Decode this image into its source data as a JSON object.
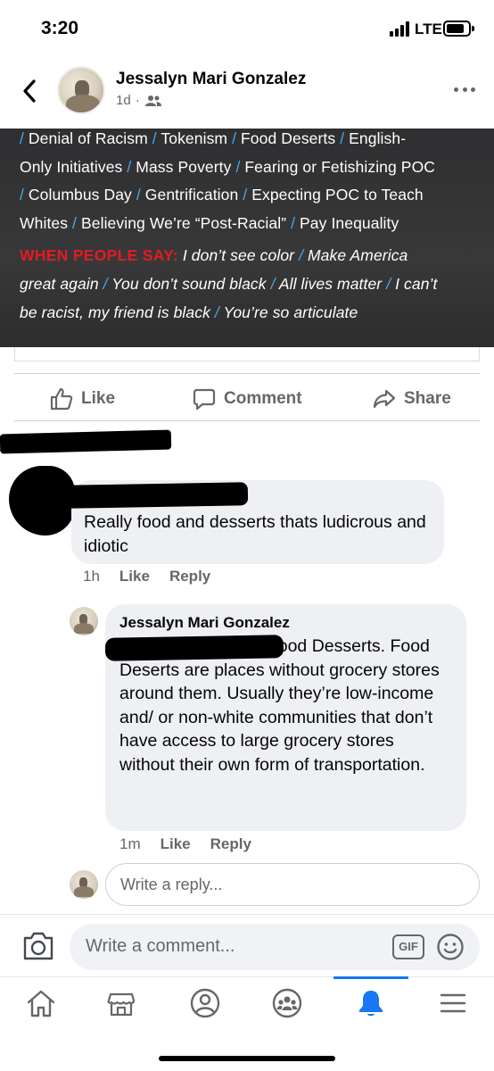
{
  "status": {
    "time": "3:20",
    "network": "LTE"
  },
  "post": {
    "author": "Jessalyn Mari Gonzalez",
    "time": "1d",
    "meta_sep": "·",
    "image": {
      "lines": [
        {
          "segments": [
            "/",
            " Denial of Racism ",
            "/",
            " Tokenism ",
            "/",
            " Food Deserts ",
            "/",
            " English-"
          ]
        },
        {
          "segments": [
            "Only Initiatives ",
            "/",
            " Mass Poverty ",
            "/",
            " Fearing or Fetishizing POC"
          ]
        },
        {
          "segments": [
            "/",
            " Columbus Day ",
            "/",
            " Gentrification ",
            "/",
            " Expecting POC to Teach"
          ]
        },
        {
          "segments": [
            "Whites ",
            "/",
            " Believing We’re “Post-Racial” ",
            "/",
            " Pay Inequality"
          ]
        },
        {
          "heading": "WHEN PEOPLE SAY:",
          "segments": [
            " I don’t see color ",
            "/",
            " Make America"
          ]
        },
        {
          "segments": [
            "great again ",
            "/",
            " You don’t sound black ",
            "/",
            " All lives matter ",
            "/",
            " I can’t"
          ]
        },
        {
          "segments": [
            "be racist, my friend is black ",
            "/",
            " You’re so articulate"
          ]
        }
      ]
    }
  },
  "actions": {
    "like": "Like",
    "comment": "Comment",
    "share": "Share"
  },
  "comments": [
    {
      "text": "Really food and desserts thats ludicrous and idiotic",
      "time": "1h",
      "like": "Like",
      "reply": "Reply"
    }
  ],
  "reply": {
    "author": "Jessalyn Mari Gonzalez",
    "text": ", Food Deserts not Food Desserts. Food Deserts are places without grocery stores around them. Usually they’re low-income and/ or non-white communities that don’t have access to large grocery stores without their own form of transportation.",
    "time": "1m",
    "like": "Like",
    "reply": "Reply"
  },
  "reply_input": {
    "placeholder": "Write a reply..."
  },
  "composer": {
    "placeholder": "Write a comment...",
    "gif": "GIF"
  },
  "colors": {
    "accent": "#1877f2",
    "meta_gray": "#65676b",
    "separator_blue": "#4aa8e6",
    "heading_red": "#e11b22"
  },
  "nav": {
    "items": [
      {
        "icon": "home-icon"
      },
      {
        "icon": "marketplace-icon"
      },
      {
        "icon": "profile-icon"
      },
      {
        "icon": "groups-icon"
      },
      {
        "icon": "notifications-bell-icon",
        "active": true
      },
      {
        "icon": "menu-icon"
      }
    ]
  }
}
